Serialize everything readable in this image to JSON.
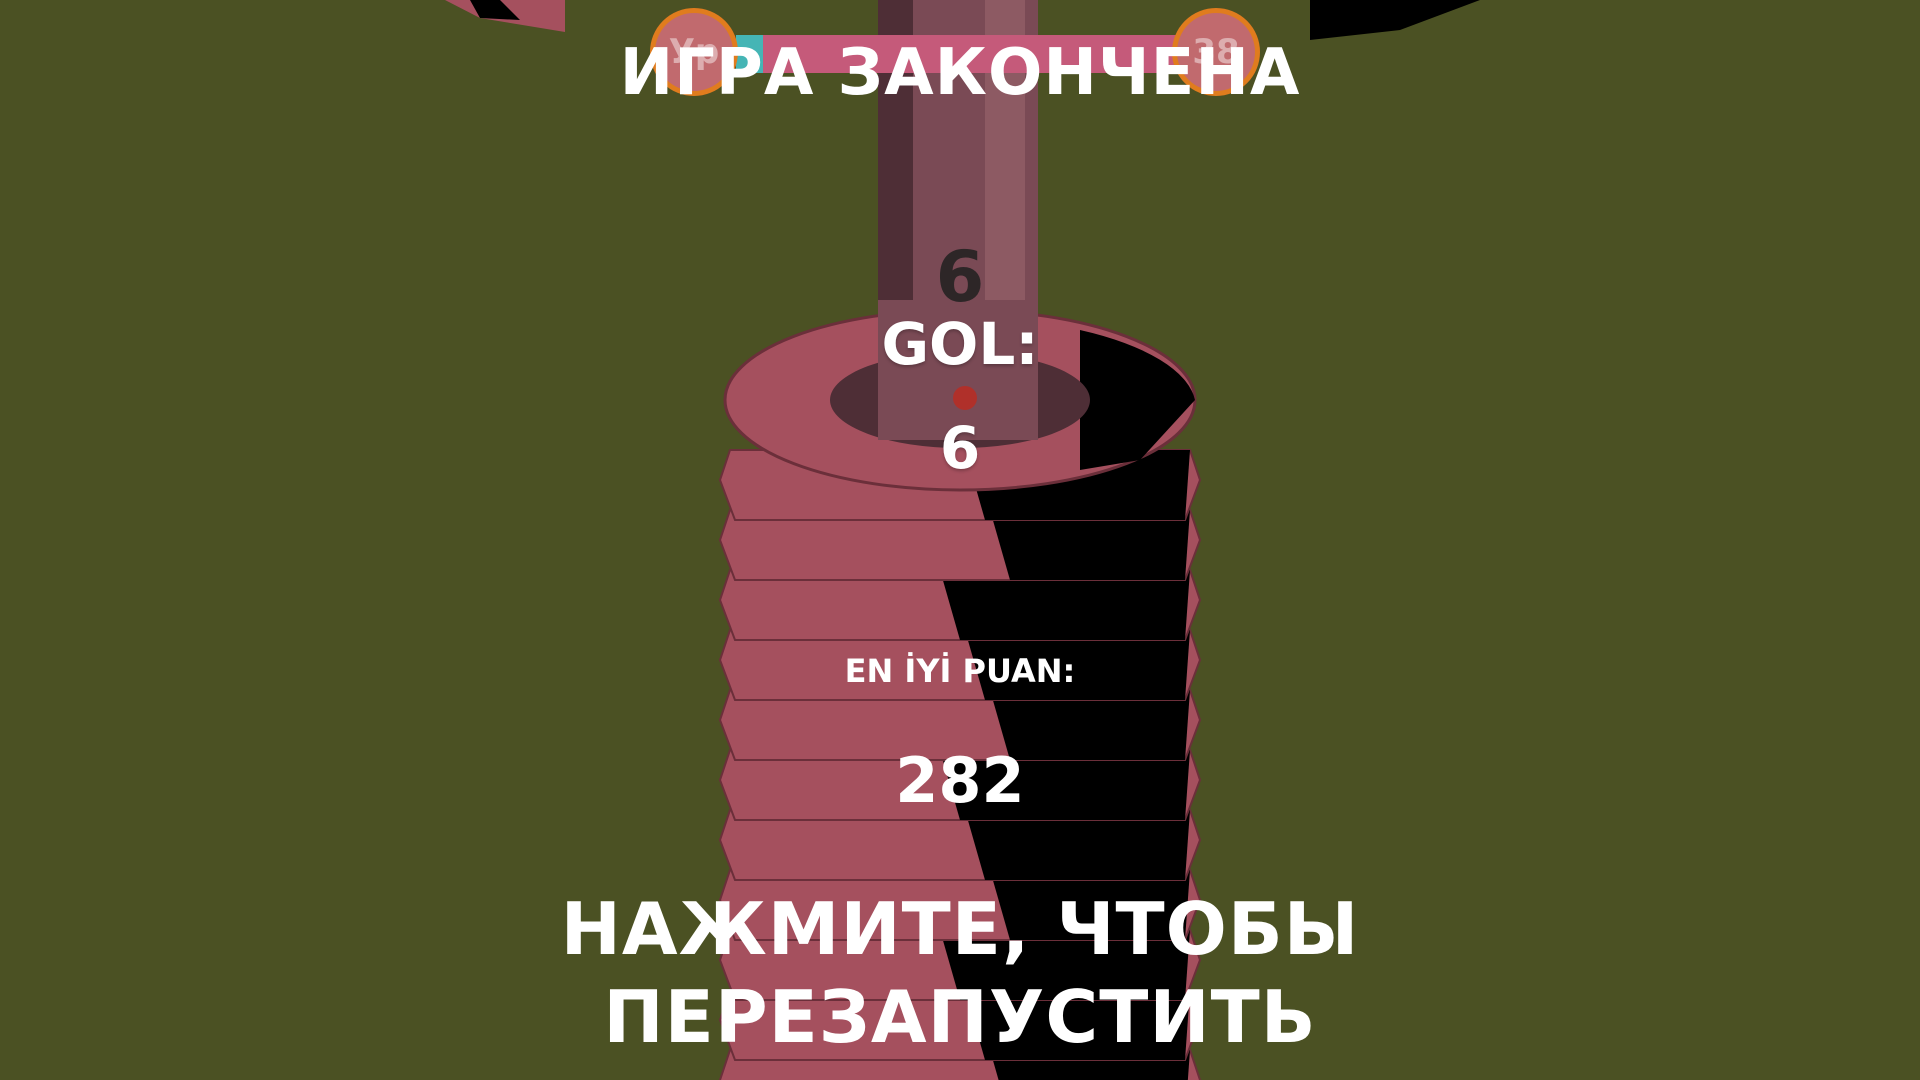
{
  "game": {
    "title": "ИГРА ЗАКОНЧЕНА",
    "level_number": "6",
    "score_label": "GOL:",
    "score_value": "6",
    "best_label": "EN İYİ PUAN:",
    "best_value": "282",
    "restart_line1": "НАЖМИТЕ, ЧТОБЫ",
    "restart_line2": "ПЕРЕЗАПУСТИТЬ"
  },
  "progress": {
    "current_level_label": "Ур",
    "next_level_label": "38",
    "fill_fraction": 0.06
  },
  "colors": {
    "background": "#4b5123",
    "tower_ring": "#a5505e",
    "pole": "#7a4a55",
    "text": "#ffffff",
    "progress_bar": "#c55a7a",
    "progress_fill": "#45b5b5",
    "level_circle_border": "#e07c1e"
  }
}
